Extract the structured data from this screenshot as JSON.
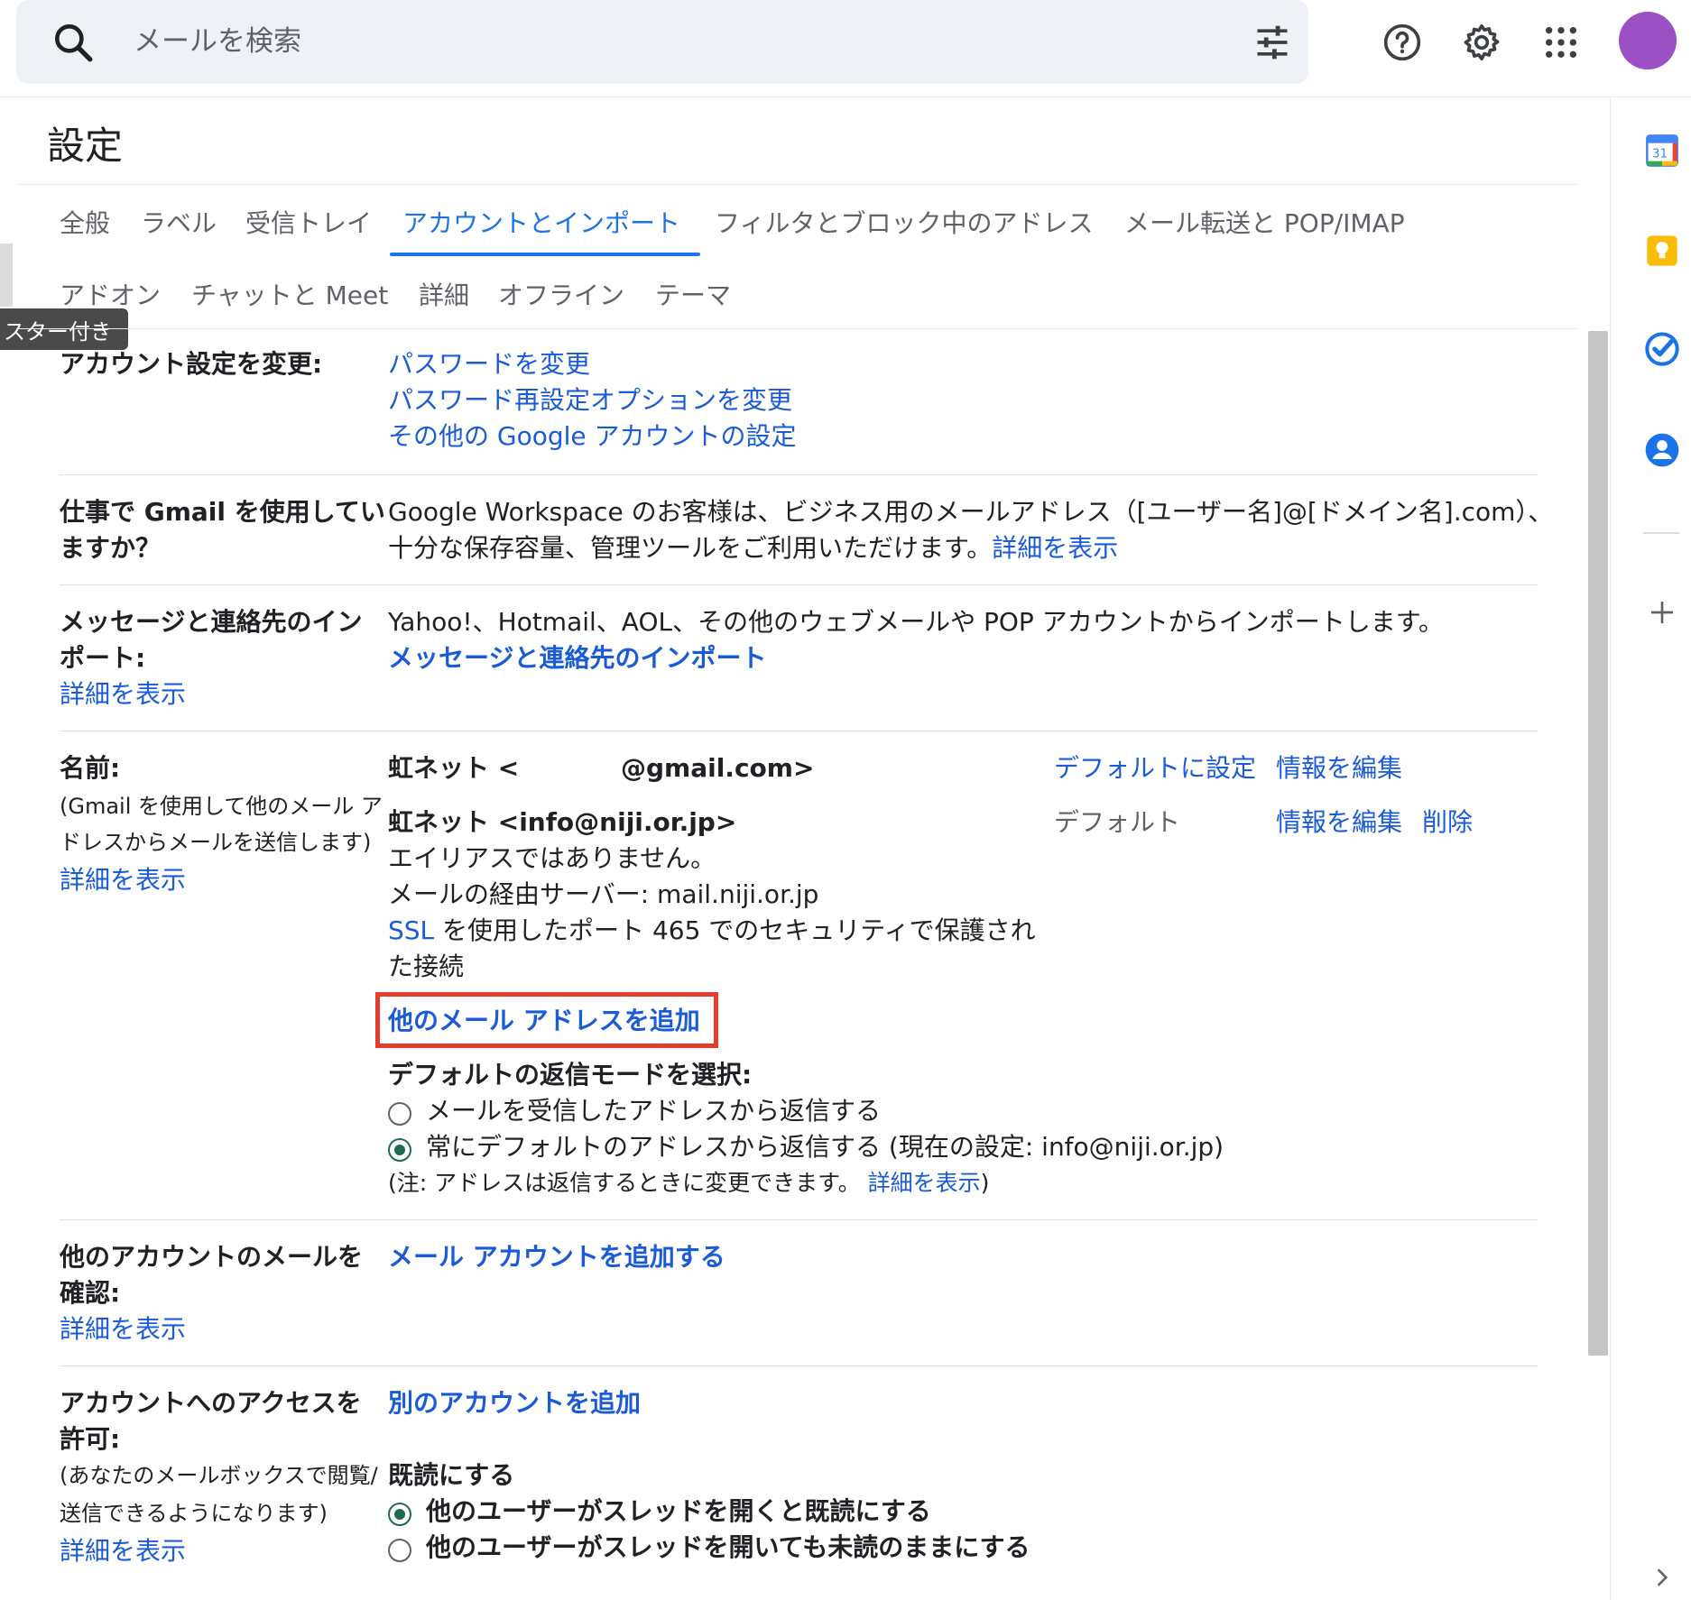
{
  "search": {
    "placeholder": "メールを検索"
  },
  "settings": {
    "title": "設定",
    "tabs_row1": [
      "全般",
      "ラベル",
      "受信トレイ",
      "アカウントとインポート",
      "フィルタとブロック中のアドレス",
      "メール転送と POP/IMAP"
    ],
    "tabs_row2": [
      "アドオン",
      "チャットと Meet",
      "詳細",
      "オフライン",
      "テーマ"
    ],
    "tooltip": "スター付き"
  },
  "account": {
    "label": "アカウント設定を変更:",
    "links": [
      "パスワードを変更",
      "パスワード再設定オプションを変更",
      "その他の Google アカウントの設定"
    ]
  },
  "workspace": {
    "label_line1": "仕事で Gmail を使用してい",
    "label_line2": "ますか？",
    "text_line1": "Google Workspace のお客様は、ビジネス用のメールアドレス（[ユーザー名]@[ドメイン名].com）、",
    "text_line2": "十分な保存容量、管理ツールをご利用いただけます。",
    "link": "詳細を表示"
  },
  "import": {
    "label_line1": "メッセージと連絡先のイン",
    "label_line2": "ポート:",
    "help_link": "詳細を表示",
    "text": "Yahoo!、Hotmail、AOL、その他のウェブメールや POP アカウントからインポートします。",
    "action_link": "メッセージと連絡先のインポート"
  },
  "name": {
    "label": "名前:",
    "sub_line1": "(Gmail を使用して他のメール ア",
    "sub_line2": "ドレスからメールを送信します)",
    "help_link": "詳細を表示",
    "entry1": {
      "name": "虹ネット <",
      "email": "@gmail.com>",
      "set_default": "デフォルトに設定",
      "edit": "情報を編集"
    },
    "entry2": {
      "name": "虹ネット <info@niji.or.jp>",
      "default_label": "デフォルト",
      "edit": "情報を編集",
      "delete": "削除",
      "alias": "エイリアスではありません。",
      "server": "メールの経由サーバー: mail.niji.or.jp",
      "ssl": "SSL",
      "security_line1": " を使用したポート 465 でのセキュリティで保護され",
      "security_line2": "た接続"
    },
    "add_address": "他のメール アドレスを追加",
    "reply_mode_title": "デフォルトの返信モードを選択:",
    "reply_option1": "メールを受信したアドレスから返信する",
    "reply_option2": "常にデフォルトのアドレスから返信する (現在の設定: info@niji.or.jp)",
    "reply_option_selected": 2,
    "note_prefix": "(注: アドレスは返信するときに変更できます。",
    "note_link": "詳細を表示",
    "note_suffix": ")"
  },
  "check_mail": {
    "label_line1": "他のアカウントのメールを",
    "label_line2": "確認:",
    "help_link": "詳細を表示",
    "action_link": "メール アカウントを追加する"
  },
  "grant_access": {
    "label_line1": "アカウントへのアクセスを",
    "label_line2": "許可:",
    "sub_line1": "(あなたのメールボックスで閲覧/",
    "sub_line2": "送信できるようになります)",
    "help_link": "詳細を表示",
    "action_link": "別のアカウントを追加",
    "mark_read_title": "既読にする",
    "option1": "他のユーザーがスレッドを開くと既読にする",
    "option2": "他のユーザーがスレッドを開いても未読のままにする",
    "option_selected": 1
  },
  "side_apps": {
    "calendar_day": "31"
  },
  "colors": {
    "accent": "#1a73e8",
    "link": "#1a5bd8",
    "highlight": "#e53b2c",
    "avatar": "#9b51c4"
  }
}
